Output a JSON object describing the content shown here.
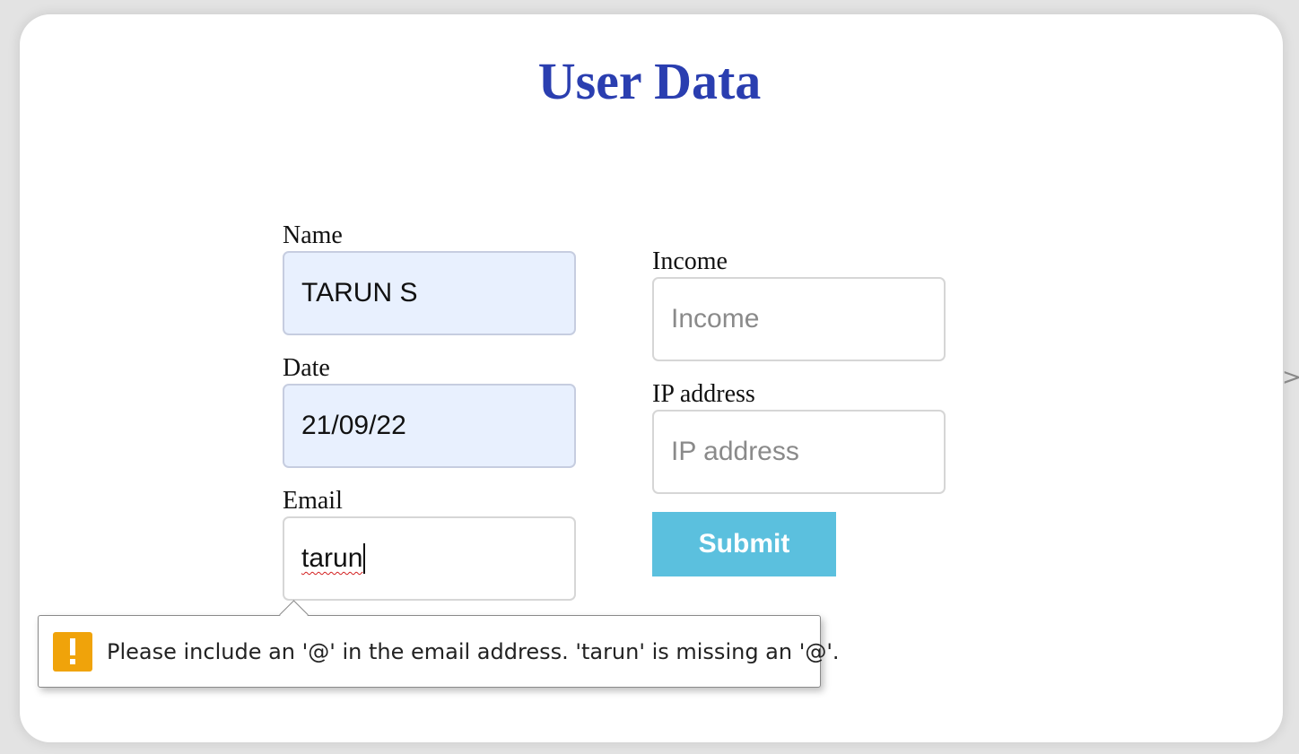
{
  "page": {
    "title": "User Data"
  },
  "form": {
    "name": {
      "label": "Name",
      "value": "TARUN S"
    },
    "date": {
      "label": "Date",
      "value": "21/09/22"
    },
    "email": {
      "label": "Email",
      "value": "tarun"
    },
    "income": {
      "label": "Income",
      "placeholder": "Income"
    },
    "ip": {
      "label": "IP address",
      "placeholder": "IP address"
    },
    "submit_label": "Submit"
  },
  "validation": {
    "icon": "warning-icon",
    "message": "Please include an '@' in the email address. 'tarun' is missing an '@'."
  },
  "edge": {
    "arrow": ">"
  },
  "colors": {
    "title": "#2a3eb0",
    "autofill_bg": "#e8f0fe",
    "submit_bg": "#5bc0de",
    "warning": "#f0a30a"
  }
}
